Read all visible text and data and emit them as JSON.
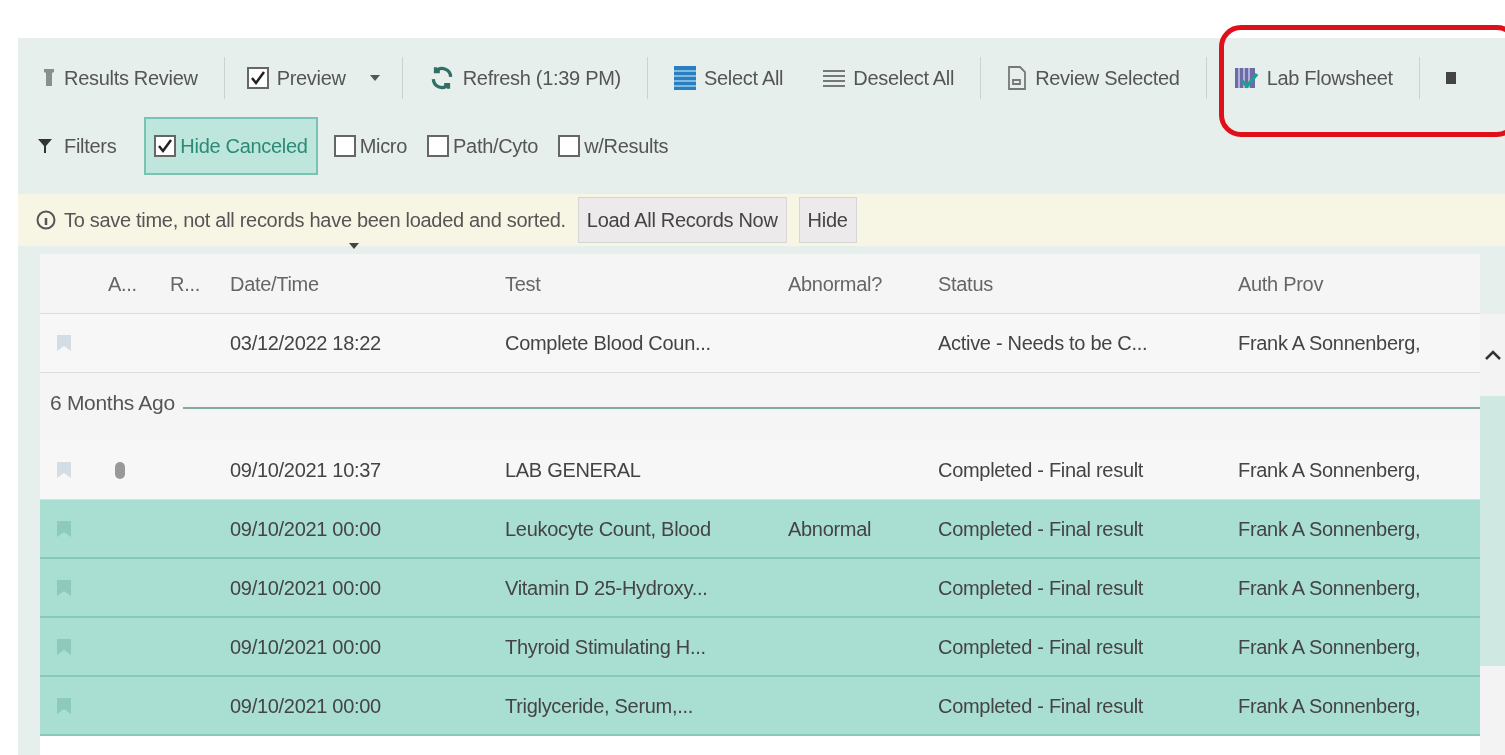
{
  "toolbar": [
    {
      "kind": "button",
      "label": "Results Review"
    },
    {
      "kind": "checkbox",
      "label": "Preview",
      "checked": true
    },
    {
      "kind": "button",
      "label": "Refresh (1:39 PM)"
    },
    {
      "kind": "button",
      "label": "Select All"
    },
    {
      "kind": "button",
      "label": "Deselect All"
    },
    {
      "kind": "button",
      "label": "Review Selected"
    },
    {
      "kind": "button",
      "label": "Lab Flowsheet"
    },
    {
      "kind": "button"
    }
  ],
  "filters": {
    "label": "Filters",
    "options": [
      {
        "label": "Hide Canceled",
        "checked": true
      },
      {
        "label": "Micro",
        "checked": false
      },
      {
        "label": "Path/Cyto",
        "checked": false
      },
      {
        "label": "w/Results",
        "checked": false
      }
    ]
  },
  "banner": {
    "message": "To save time, not all records have been loaded and sorted.",
    "buttons": [
      "Load All Records Now",
      "Hide"
    ]
  },
  "table": {
    "columns": [
      "A...",
      "R...",
      "Date/Time",
      "Test",
      "Abnormal?",
      "Status",
      "Auth Prov"
    ],
    "rows": [
      {
        "kind": "row",
        "selected": false,
        "attachment": false,
        "cells": [
          "03/12/2022 18:22",
          "Complete Blood Coun...",
          "",
          "Active - Needs to be C...",
          "Frank A Sonnenberg,"
        ]
      },
      {
        "kind": "group",
        "label": "6 Months Ago"
      },
      {
        "kind": "row",
        "selected": false,
        "attachment": true,
        "cells": [
          "09/10/2021 10:37",
          "LAB GENERAL",
          "",
          "Completed - Final result",
          "Frank A Sonnenberg,"
        ]
      },
      {
        "kind": "row",
        "selected": true,
        "attachment": false,
        "cells": [
          "09/10/2021 00:00",
          "Leukocyte Count, Blood",
          "Abnormal",
          "Completed - Final result",
          "Frank A Sonnenberg,"
        ]
      },
      {
        "kind": "row",
        "selected": true,
        "attachment": false,
        "cells": [
          "09/10/2021 00:00",
          "Vitamin D 25-Hydroxy...",
          "",
          "Completed - Final result",
          "Frank A Sonnenberg,"
        ]
      },
      {
        "kind": "row",
        "selected": true,
        "attachment": false,
        "cells": [
          "09/10/2021 00:00",
          "Thyroid Stimulating H...",
          "",
          "Completed - Final result",
          "Frank A Sonnenberg,"
        ]
      },
      {
        "kind": "row",
        "selected": true,
        "attachment": false,
        "cells": [
          "09/10/2021 00:00",
          "Triglyceride, Serum,...",
          "",
          "Completed - Final result",
          "Frank A Sonnenberg,"
        ]
      }
    ]
  }
}
